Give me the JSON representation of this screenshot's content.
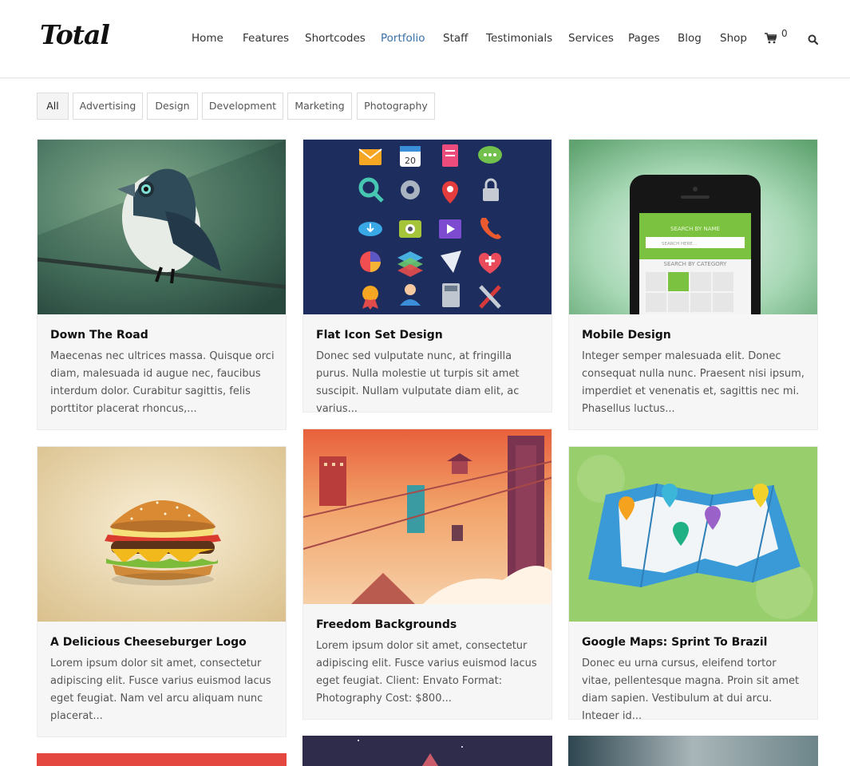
{
  "header": {
    "logo": "Total",
    "nav": [
      {
        "label": "Home",
        "active": false
      },
      {
        "label": "Features",
        "active": false
      },
      {
        "label": "Shortcodes",
        "active": false
      },
      {
        "label": "Portfolio",
        "active": true
      },
      {
        "label": "Staff",
        "active": false
      },
      {
        "label": "Testimonials",
        "active": false
      },
      {
        "label": "Services",
        "active": false
      },
      {
        "label": "Pages",
        "active": false
      },
      {
        "label": "Blog",
        "active": false
      },
      {
        "label": "Shop",
        "active": false
      }
    ],
    "cart_count": "0",
    "cart_icon": "cart-icon",
    "search_icon": "search-icon"
  },
  "filters": [
    {
      "label": "All",
      "active": true
    },
    {
      "label": "Advertising",
      "active": false
    },
    {
      "label": "Design",
      "active": false
    },
    {
      "label": "Development",
      "active": false
    },
    {
      "label": "Marketing",
      "active": false
    },
    {
      "label": "Photography",
      "active": false
    }
  ],
  "items": [
    {
      "title": "Down The Road",
      "excerpt": "Maecenas nec ultrices massa. Quisque orci diam, malesuada id augue nec, faucibus interdum dolor. Curabitur sagittis, felis porttitor placerat rhoncus,..."
    },
    {
      "title": "Flat Icon Set Design",
      "excerpt": "Donec sed vulputate nunc, at fringilla purus. Nulla molestie ut turpis sit amet suscipit. Nullam vulputate diam elit, ac varius..."
    },
    {
      "title": "Mobile Design",
      "excerpt": "Integer semper malesuada elit. Donec consequat nulla nunc. Praesent nisi ipsum, imperdiet et venenatis et, sagittis nec mi. Phasellus luctus..."
    },
    {
      "title": "A Delicious Cheeseburger Logo",
      "excerpt": "Lorem ipsum dolor sit amet, consectetur adipiscing elit. Fusce varius euismod lacus eget feugiat. Nam vel arcu aliquam nunc placerat..."
    },
    {
      "title": "Freedom Backgrounds",
      "excerpt": "Lorem ipsum dolor sit amet, consectetur adipiscing elit. Fusce varius euismod lacus eget feugiat. Client: Envato Format: Photography Cost: $800..."
    },
    {
      "title": "Google Maps: Sprint To Brazil",
      "excerpt": "Donec eu urna cursus, eleifend tortor vitae, pellentesque magna. Proin sit amet diam sapien. Vestibulum at dui arcu. Integer id..."
    }
  ],
  "phone_ui": {
    "search_by_name": "SEARCH BY NAME",
    "search_here": "SEARCH HERE...",
    "search_by_category": "SEARCH BY CATEGORY"
  },
  "calendar_icon_day": "20",
  "colors": {
    "accent": "#3b71a4",
    "card_bg": "#f6f6f6",
    "border": "#dcdcdc"
  }
}
